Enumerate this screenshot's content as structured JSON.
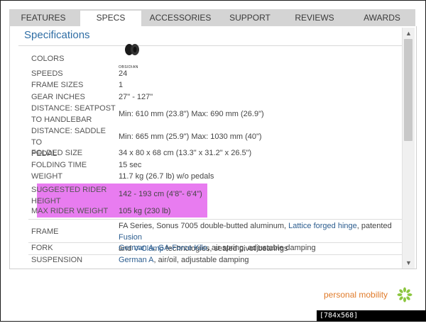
{
  "tabs": [
    {
      "label": "FEATURES",
      "active": false
    },
    {
      "label": "SPECS",
      "active": true
    },
    {
      "label": "ACCESSORIES",
      "active": false
    },
    {
      "label": "SUPPORT",
      "active": false
    },
    {
      "label": "REVIEWS",
      "active": false
    },
    {
      "label": "AWARDS",
      "active": false
    }
  ],
  "section_title": "Specifications",
  "specs": {
    "colors": {
      "label": "COLORS",
      "swatch_name": "OBSIDIAN"
    },
    "speeds": {
      "label": "SPEEDS",
      "value": "24"
    },
    "frame_sizes": {
      "label": "FRAME SIZES",
      "value": "1"
    },
    "gear_inches": {
      "label": "GEAR INCHES",
      "value": "27\" - 127\""
    },
    "seatpost": {
      "label1": "DISTANCE: SEATPOST",
      "label2": "TO HANDLEBAR",
      "value": "Min: 610 mm (23.8\") Max: 690 mm (26.9\")"
    },
    "saddle": {
      "label1": "DISTANCE: SADDLE TO",
      "label2": "PEDAL",
      "value": "Min: 665 mm (25.9\") Max: 1030 mm (40\")"
    },
    "folded_size": {
      "label": "FOLDED SIZE",
      "value": "34 x 80 x 68 cm (13.3\" x 31.2\" x 26.5\")"
    },
    "folding_time": {
      "label": "FOLDING TIME",
      "value": "15 sec"
    },
    "weight": {
      "label": "WEIGHT",
      "value": "11.7 kg (26.7 lb) w/o pedals"
    },
    "rider_height": {
      "label1": "SUGGESTED RIDER",
      "label2": "HEIGHT",
      "value": "142 - 193 cm (4'8\"- 6'4\")"
    },
    "rider_weight": {
      "label": "MAX RIDER WEIGHT",
      "value": "105 kg (230 lb)"
    },
    "frame": {
      "label": "FRAME",
      "text1": "FA Series, Sonus 7005 double-butted aluminum, ",
      "link1": "Lattice forged hinge",
      "text2": ", patented ",
      "link2": "Fusion",
      "text3": "and ",
      "link3": "V-Clamp",
      "text4": " technologies, sealed pivot bearings"
    },
    "fork": {
      "label": "FORK",
      "link1": "German A",
      "sep": ", ",
      "link2": "GA-Force Kilo",
      "text": ", air spring, adjustable damping"
    },
    "suspension": {
      "label": "SUSPENSION",
      "link1": "German A",
      "text": ", air/oil, adjustable damping"
    }
  },
  "footer": {
    "brand_text": "personal mobility"
  },
  "watermark": "[784x568] https://upic.me/",
  "colors": {
    "highlight": "#e87cf0",
    "link": "#2c5d8f",
    "title": "#2e6da4",
    "brand_orange": "#e07b2a",
    "logo_green": "#8cc63f"
  }
}
